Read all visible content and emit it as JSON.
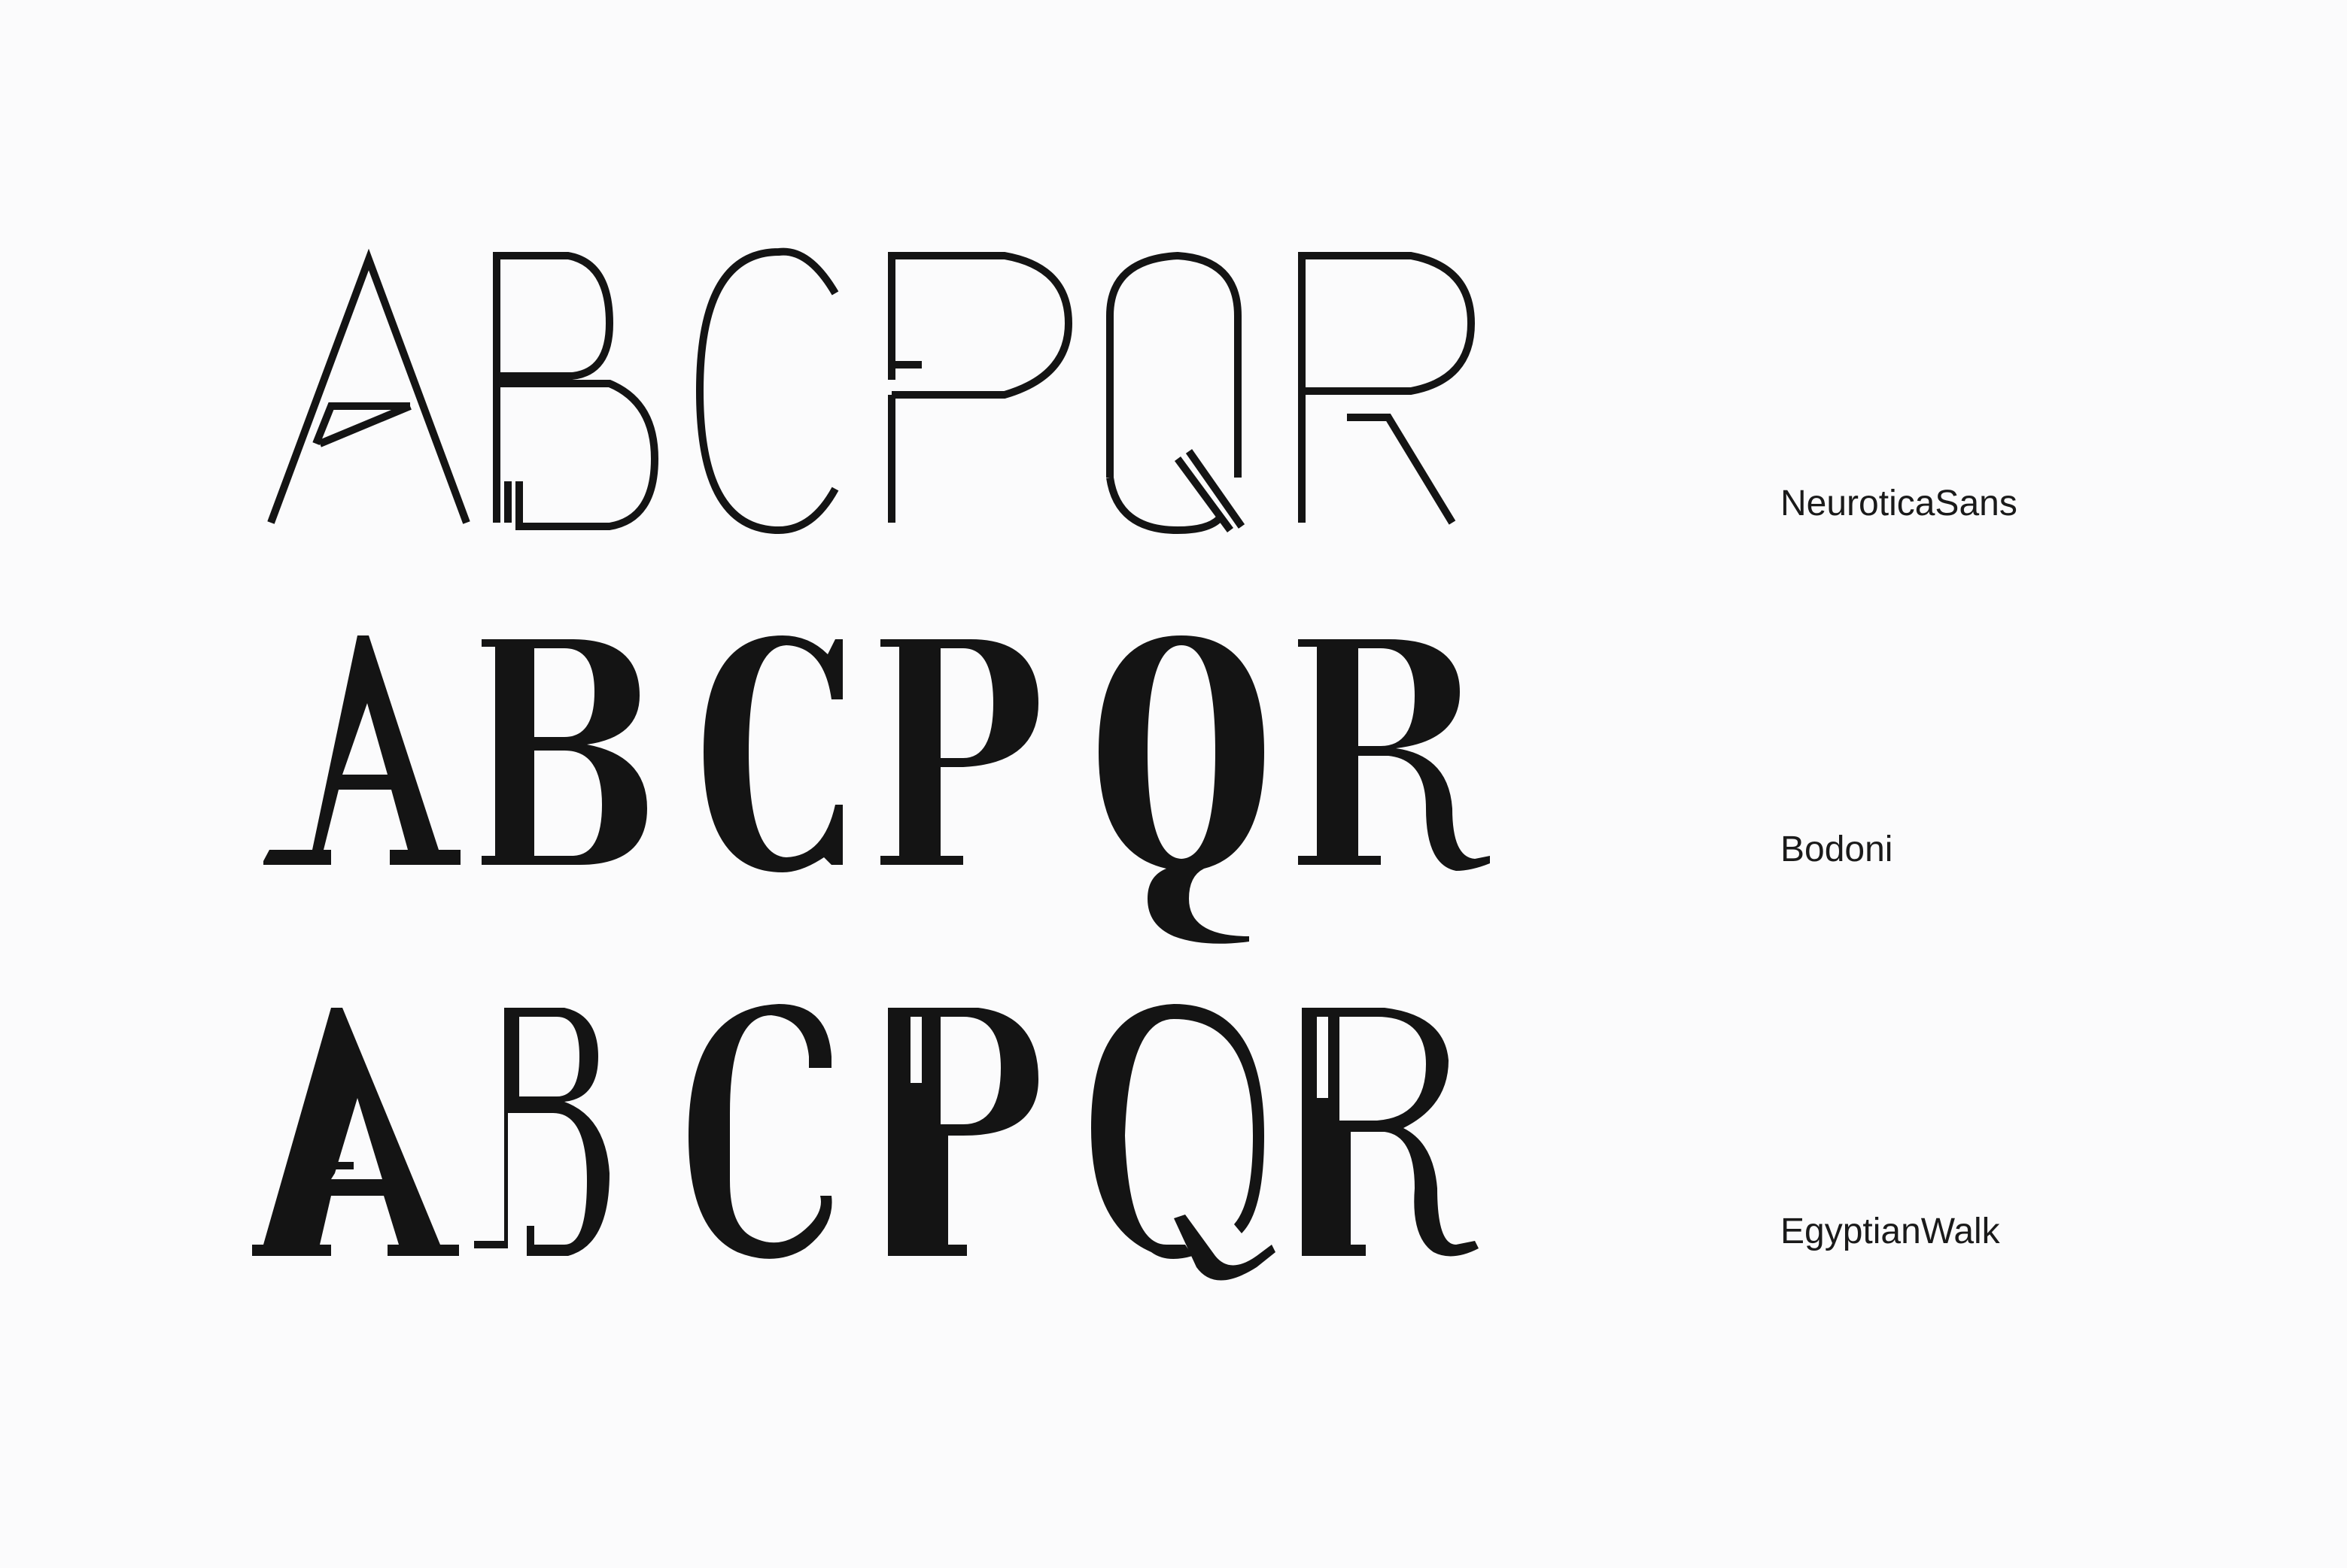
{
  "specimen": {
    "letters": [
      "A",
      "B",
      "C",
      "P",
      "Q",
      "R"
    ],
    "rows": [
      {
        "font_name": "NeuroticaSans"
      },
      {
        "font_name": "Bodoni"
      },
      {
        "font_name": "EgyptianWalk"
      }
    ]
  },
  "colors": {
    "background": "#fbfbfc",
    "ink": "#141414"
  }
}
